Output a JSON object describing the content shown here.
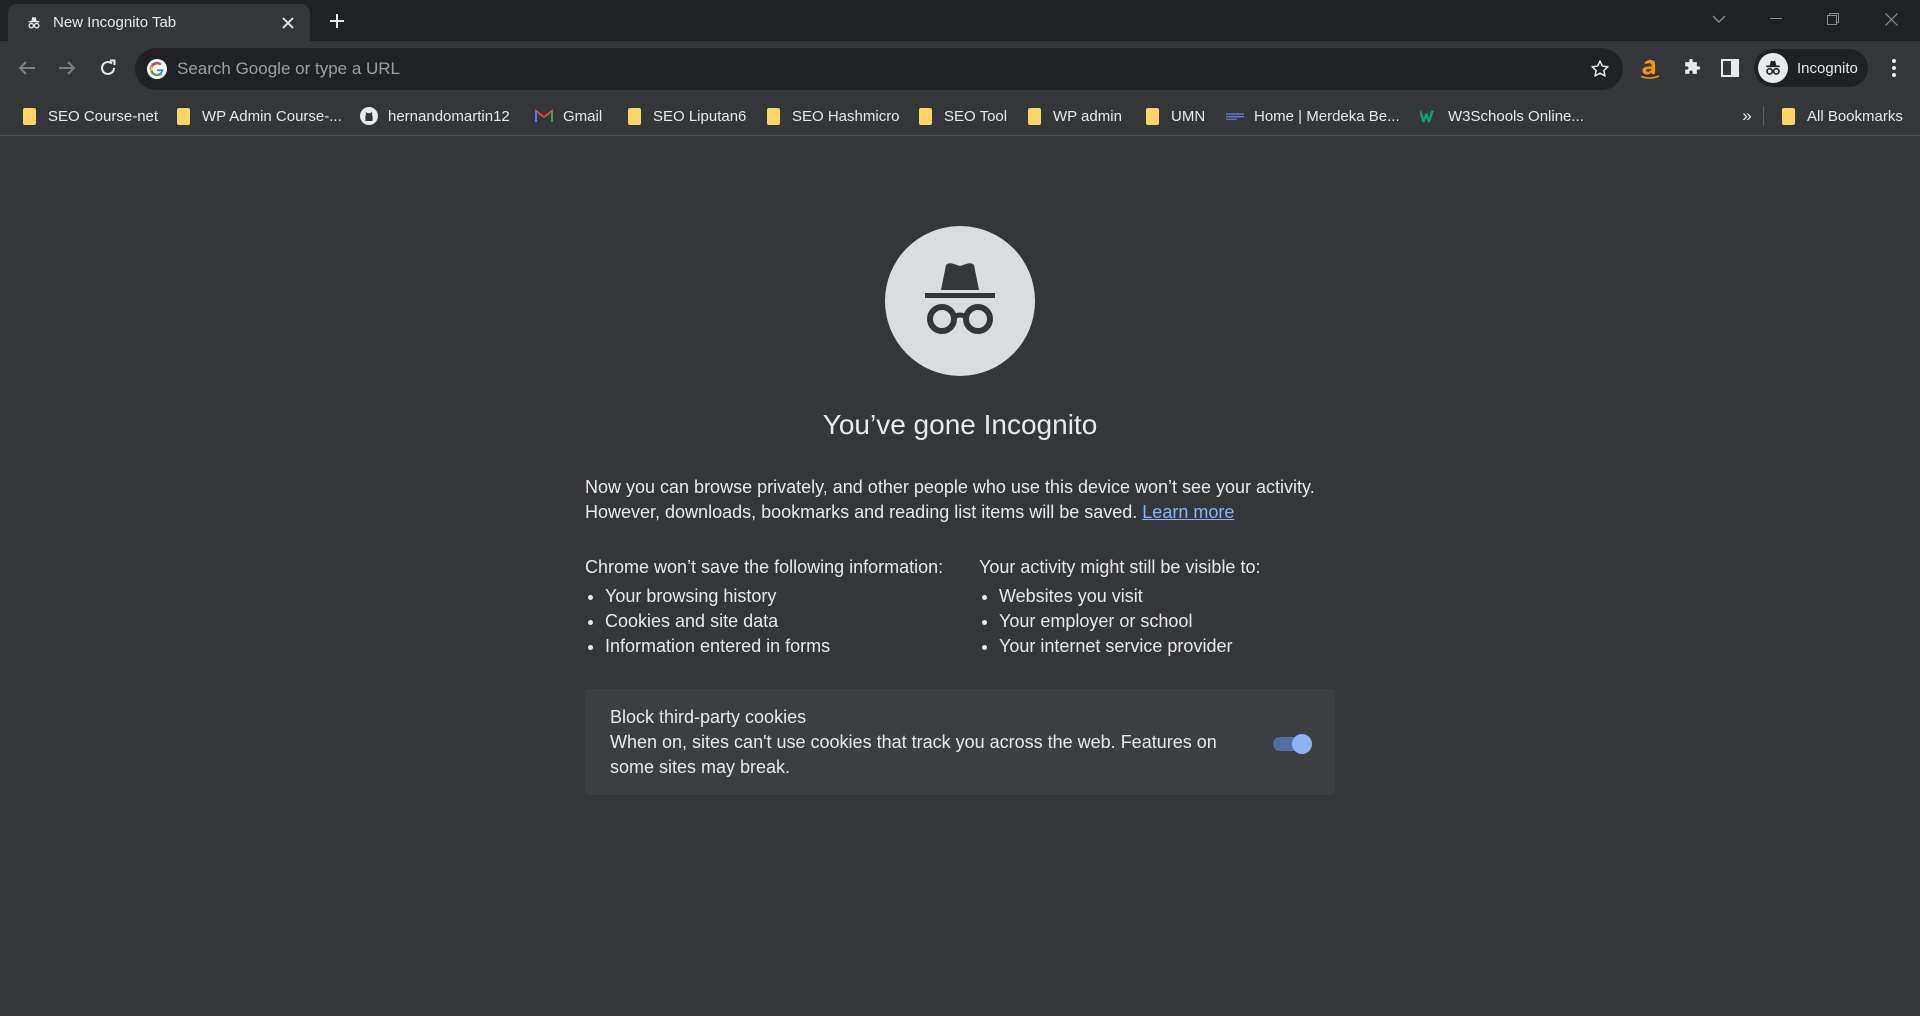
{
  "tab": {
    "title": "New Incognito Tab"
  },
  "omnibox": {
    "placeholder": "Search Google or type a URL"
  },
  "profile": {
    "label": "Incognito"
  },
  "bookmarks": [
    {
      "label": "SEO Course-net",
      "icon": "folder-icon"
    },
    {
      "label": "WP Admin Course-...",
      "icon": "folder-icon"
    },
    {
      "label": "hernandomartin12",
      "icon": "github-icon"
    },
    {
      "label": "Gmail",
      "icon": "gmail-icon"
    },
    {
      "label": "SEO Liputan6",
      "icon": "folder-icon"
    },
    {
      "label": "SEO Hashmicro",
      "icon": "folder-icon"
    },
    {
      "label": "SEO Tool",
      "icon": "folder-icon"
    },
    {
      "label": "WP admin",
      "icon": "folder-icon"
    },
    {
      "label": "UMN",
      "icon": "folder-icon"
    },
    {
      "label": "Home | Merdeka Be...",
      "icon": "merdeka-icon"
    },
    {
      "label": "W3Schools Online...",
      "icon": "w3schools-icon"
    }
  ],
  "bookmarks_overflow": "»",
  "all_bookmarks": "All Bookmarks",
  "page": {
    "heading": "You’ve gone Incognito",
    "intro_line1": "Now you can browse privately, and other people who use this device won’t see your activity.",
    "intro_line2": "However, downloads, bookmarks and reading list items will be saved.",
    "learn_more": "Learn more",
    "left_col": {
      "heading_pre": "Chrome ",
      "heading_bold": "won’t save",
      "heading_post": " the following information:",
      "items": [
        "Your browsing history",
        "Cookies and site data",
        "Information entered in forms"
      ]
    },
    "right_col": {
      "heading_pre": "Your activity ",
      "heading_bold": "might still be visible",
      "heading_post": " to:",
      "items": [
        "Websites you visit",
        "Your employer or school",
        "Your internet service provider"
      ]
    },
    "cookie_card": {
      "title": "Block third-party cookies",
      "description": "When on, sites can't use cookies that track you across the web. Features on some sites may break.",
      "toggle_on": true
    }
  },
  "colors": {
    "background": "#35363a",
    "frame": "#202124",
    "link": "#8ab4f8",
    "folder": "#fdd663",
    "extension_accent": "#f29900"
  }
}
